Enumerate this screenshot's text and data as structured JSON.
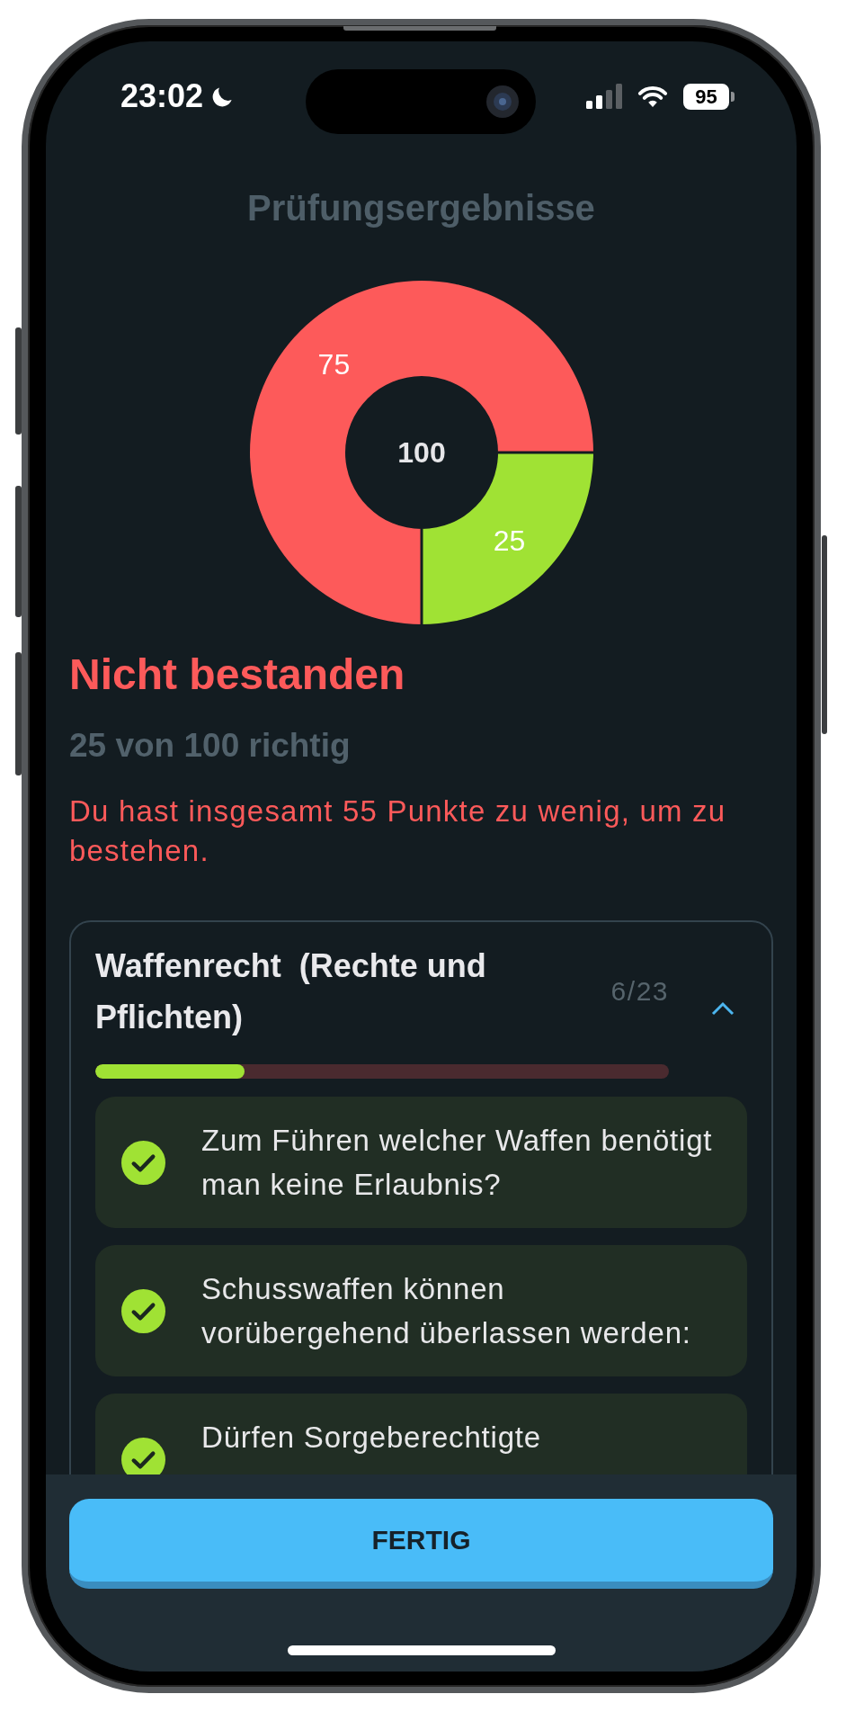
{
  "status_bar": {
    "time": "23:02",
    "battery": "95"
  },
  "title": "Prüfungsergebnisse",
  "chart": {
    "chart_data": {
      "type": "donut",
      "values": [
        75,
        25
      ],
      "colors": [
        "#fd5a5a",
        "#a0e234"
      ],
      "data_labels": true,
      "annotations": [
        {
          "text": "100"
        }
      ]
    }
  },
  "result": {
    "passed": false,
    "status": "Nicht bestanden",
    "score": "25 von 100 richtig",
    "message": "Du hast insgesamt 55 Punkte zu wenig, um zu bestehen."
  },
  "categories": [
    {
      "title": "Waffenrecht  (Rechte und Pflichten)",
      "count": "6/23",
      "expanded": true,
      "level": 0.26,
      "questions": [
        {
          "text": "Zum Führen welcher Waffen benötigt man keine Erlaubnis?",
          "correct": true
        },
        {
          "text": "Schusswaffen können vorübergehend überlassen werden:",
          "correct": true
        },
        {
          "text": "Dürfen Sorgeberechtigte",
          "correct": true
        }
      ]
    }
  ],
  "button": "FERTIG"
}
